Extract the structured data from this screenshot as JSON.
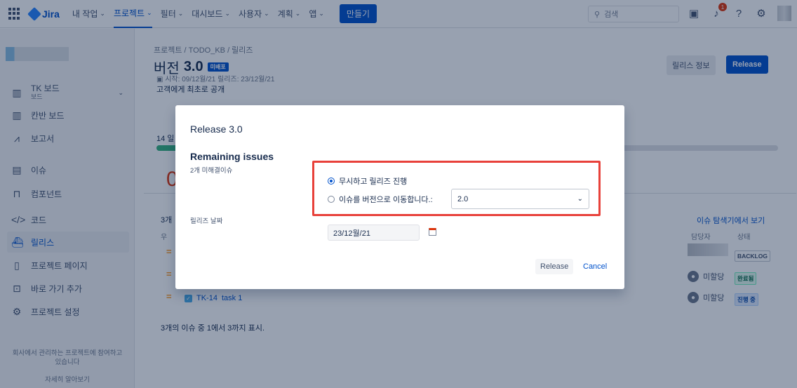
{
  "topnav": {
    "logo": "Jira",
    "items": [
      "내 작업",
      "프로젝트",
      "필터",
      "대시보드",
      "사용자",
      "계획",
      "앱"
    ],
    "create": "만들기",
    "search_placeholder": "검색",
    "notif_count": "1"
  },
  "sidebar": {
    "board_title": "TK 보드",
    "board_sub": "보드",
    "items": [
      "칸반 보드",
      "보고서",
      "이슈",
      "컴포넌트",
      "코드",
      "릴리스",
      "프로젝트 페이지",
      "바로 가기 추가",
      "프로젝트 설정"
    ],
    "footer_line1": "회사에서 관리하는 프로젝트에 참여하고",
    "footer_line2": "있습니다",
    "footer_link": "자세히 알아보기"
  },
  "main": {
    "breadcrumb": "프로젝트 / TODO_KB / 릴리즈",
    "title_prefix": "버전",
    "version": "3.0",
    "badge": "미배포",
    "dates": "시작: 09/12월/21   릴리즈: 23/12월/21",
    "description": "고객에게 최초로 공개",
    "btn_info": "릴리스 정보",
    "btn_release": "Release",
    "days": "14 일",
    "progress": 0.03,
    "big_number": "0",
    "issue_count": "3개",
    "col_priority": "우",
    "view_link": "이슈 탐색기에서 보기",
    "col_assignee": "담당자",
    "col_status": "상태",
    "issue_key": "TK-14",
    "issue_summary": "task 1",
    "unassigned": "미할당",
    "statuses": [
      "BACKLOG",
      "완료됨",
      "진행 중"
    ],
    "showing": "3개의 이슈 중 1에서 3까지 표시."
  },
  "dialog": {
    "title": "Release 3.0",
    "section": "Remaining issues",
    "remaining": "2개 미해결이슈",
    "opt_ignore": "무시하고 릴리즈 진행",
    "opt_move": "이슈를 버전으로 이동합니다.:",
    "select_value": "2.0",
    "date_label": "릴리즈 날짜",
    "date_value": "23/12월/21",
    "btn_release": "Release",
    "btn_cancel": "Cancel"
  },
  "colors": {
    "brand": "#0052cc",
    "highlight": "#e8413a",
    "done": "#36b37e"
  }
}
